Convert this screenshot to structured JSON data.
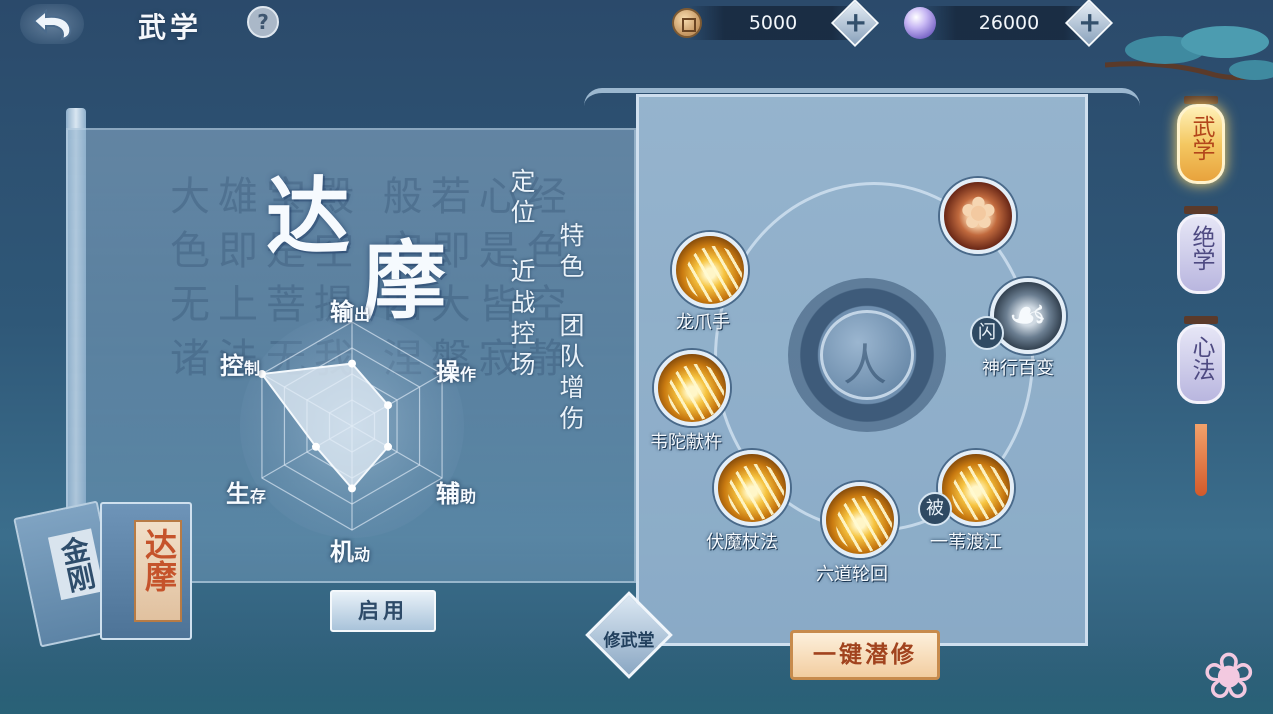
{
  "header": {
    "title": "武学",
    "help": "?"
  },
  "currency": {
    "coins": "5000",
    "gems": "26000",
    "plus": "+"
  },
  "character": {
    "name_char1": "达",
    "name_char2": "摩",
    "position_label": "定位",
    "position_value": "近战控场",
    "feature_label": "特色",
    "feature_value": "团队增伤"
  },
  "radar": {
    "labels": {
      "output": [
        "输",
        "出"
      ],
      "operation": [
        "操",
        "作"
      ],
      "support": [
        "辅",
        "助"
      ],
      "mobility": [
        "机",
        "动"
      ],
      "survival": [
        "生",
        "存"
      ],
      "control": [
        "控",
        "制"
      ]
    },
    "scale_max": 5,
    "values": {
      "output": 3,
      "operation": 2,
      "support": 2,
      "mobility": 3,
      "survival": 2,
      "control": 5
    }
  },
  "background_calligraphy": "大雄宝殿 般若心经 色即是空 空即是色 无上菩提 四大皆空 诸法无我 涅槃寂静",
  "enable_button": "启用",
  "books": {
    "back_label": "金刚",
    "front_label": "达摩"
  },
  "skills": [
    {
      "id": "longzhuashou",
      "name": "龙爪手"
    },
    {
      "id": "lotus",
      "name": ""
    },
    {
      "id": "shenxing",
      "name": "神行百变",
      "tag": "闪"
    },
    {
      "id": "weituo",
      "name": "韦陀献杵"
    },
    {
      "id": "fumo",
      "name": "伏魔杖法"
    },
    {
      "id": "liudao",
      "name": "六道轮回"
    },
    {
      "id": "yiwei",
      "name": "一苇渡江",
      "tag": "被"
    }
  ],
  "center_glyph": "人",
  "xiuwutang": "修武堂",
  "yijian": "一键潜修",
  "side_tabs": [
    {
      "label": "武学",
      "active": true
    },
    {
      "label": "绝学",
      "active": false
    },
    {
      "label": "心法",
      "active": false
    }
  ],
  "colors": {
    "accent_gold": "#f4c862",
    "panel_blue": "#9bb9d2",
    "button_orange_text": "#a1431e"
  }
}
